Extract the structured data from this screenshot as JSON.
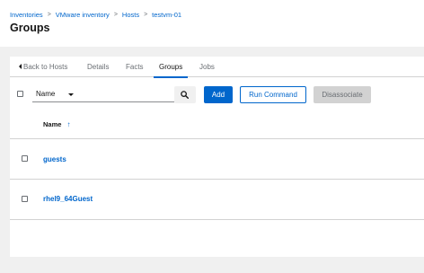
{
  "breadcrumb": {
    "items": [
      "Inventories",
      "VMware inventory",
      "Hosts",
      "testvm-01"
    ],
    "separator": ">"
  },
  "page": {
    "title": "Groups"
  },
  "tabs": {
    "back_label": "Back to Hosts",
    "items": [
      "Details",
      "Facts",
      "Groups",
      "Jobs"
    ],
    "active": "Groups"
  },
  "toolbar": {
    "filter_select": "Name",
    "search_placeholder": "",
    "add_label": "Add",
    "run_command_label": "Run Command",
    "disassociate_label": "Disassociate"
  },
  "table": {
    "columns": [
      {
        "label": "Name",
        "sort_indicator": "↑"
      }
    ],
    "rows": [
      {
        "name": "guests"
      },
      {
        "name": "rhel9_64Guest"
      }
    ]
  },
  "colors": {
    "accent": "#0066cc",
    "page_background": "#f0f0f0",
    "border": "#d2d2d2"
  }
}
